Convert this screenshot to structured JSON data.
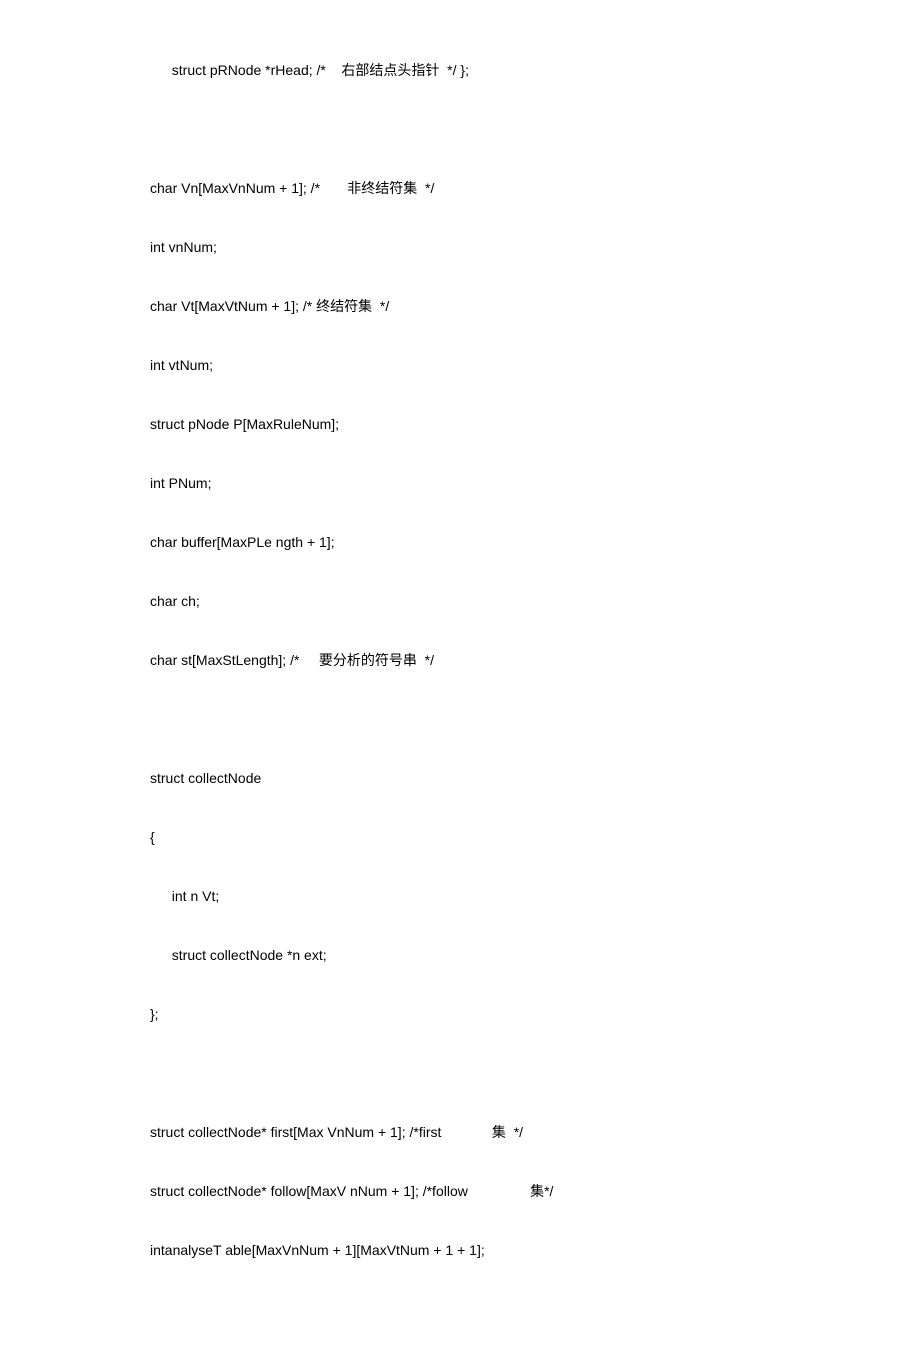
{
  "lines": [
    {
      "text": "  struct pRNode *rHead; /*    右部结点头指针  */ };",
      "indent": true
    },
    {
      "text": "",
      "indent": false
    },
    {
      "text": "char Vn[MaxVnNum + 1]; /*       非终结符集  */",
      "indent": false
    },
    {
      "text": "int vnNum;",
      "indent": false
    },
    {
      "text": "char Vt[MaxVtNum + 1]; /* 终结符集  */",
      "indent": false
    },
    {
      "text": "int vtNum;",
      "indent": false
    },
    {
      "text": "struct pNode P[MaxRuleNum];",
      "indent": false
    },
    {
      "text": "int PNum;",
      "indent": false
    },
    {
      "text": "char buffer[MaxPLe ngth + 1];",
      "indent": false
    },
    {
      "text": "char ch;",
      "indent": false
    },
    {
      "text": "char st[MaxStLength]; /*     要分析的符号串  */",
      "indent": false
    },
    {
      "text": "",
      "indent": false
    },
    {
      "text": "struct collectNode",
      "indent": false
    },
    {
      "text": "{",
      "indent": false
    },
    {
      "text": "  int n Vt;",
      "indent": true
    },
    {
      "text": "  struct collectNode *n ext;",
      "indent": true
    },
    {
      "text": "};",
      "indent": false
    },
    {
      "text": "",
      "indent": false
    },
    {
      "text": "struct collectNode* first[Max VnNum + 1]; /*first             集  */",
      "indent": false
    },
    {
      "text": "struct collectNode* follow[MaxV nNum + 1]; /*follow                集*/",
      "indent": false
    },
    {
      "text": "intanalyseT able[MaxVnNum + 1][MaxVtNum + 1 + 1];",
      "indent": false
    }
  ]
}
